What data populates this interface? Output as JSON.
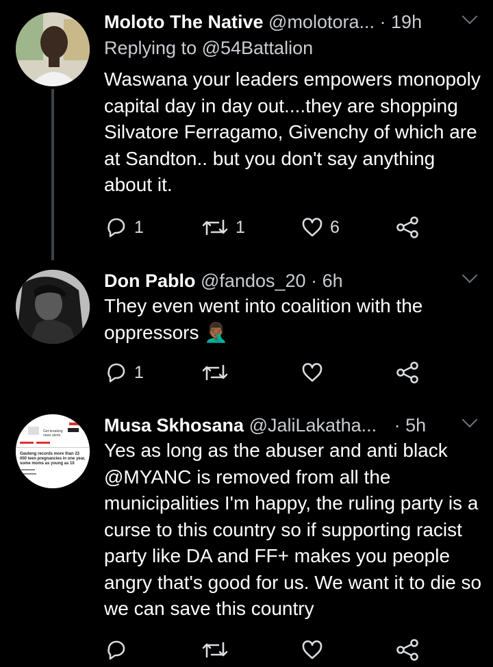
{
  "tweets": [
    {
      "name": "Moloto The Native",
      "handle": "@molotora...",
      "dot": "·",
      "time": "19h",
      "replying_to": "Replying to @54Battalion",
      "text": "Waswana your leaders empowers monopoly capital day in day out....they are shopping  Silvatore Ferragamo, Givenchy of which are at Sandton.. but you don't say anything about it.",
      "replies": "1",
      "retweets": "1",
      "likes": "6"
    },
    {
      "name": "Don Pablo",
      "handle": "@fandos_20",
      "dot": "·",
      "time": "6h",
      "text": "They even went into coalition with the oppressors 🤦🏾‍♂️",
      "replies": "1",
      "retweets": "",
      "likes": ""
    },
    {
      "name": "Musa Skhosana",
      "handle": "@JaliLakatha...",
      "dot": "·",
      "time": "5h",
      "text_mention": "@MYANC",
      "text_before": "Yes as long as the abuser and anti black",
      "text_after": "is removed from all the municipalities I'm happy, the ruling party is a curse to this country so if supporting racist party like DA and FF+ makes you people angry that's good for us. We want it to die so we can save this country",
      "replies": "",
      "retweets": "",
      "likes": "",
      "avatar_thumb": {
        "small_text": "Get breaking news alerts",
        "headline": "Gauteng records more than 23 000 teen pregnancies in one year, some moms as young as 10"
      }
    }
  ],
  "icons": {
    "reply": "reply-icon",
    "retweet": "retweet-icon",
    "like": "heart-icon",
    "share": "share-icon",
    "more": "chevron-down-icon"
  },
  "colors": {
    "background": "#000000",
    "secondary": "#c9cdd1",
    "icon": "#d9dde0"
  }
}
